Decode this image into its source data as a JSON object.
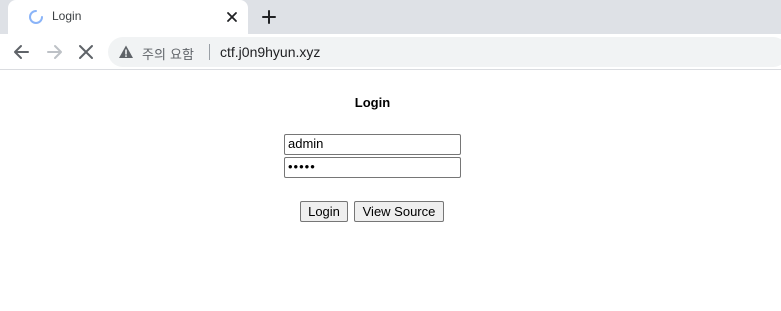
{
  "browser": {
    "tab": {
      "title": "Login"
    },
    "address_bar": {
      "security_label": "주의 요함",
      "url": "ctf.j0n9hyun.xyz"
    }
  },
  "page": {
    "heading": "Login",
    "username_value": "admin",
    "password_value": "•••••",
    "login_button": "Login",
    "view_source_button": "View Source"
  },
  "icons": {
    "tab_loading": "loading-spinner-icon",
    "tab_close": "close-icon",
    "new_tab": "plus-icon",
    "back": "arrow-left-icon",
    "forward": "arrow-right-icon",
    "stop": "stop-x-icon",
    "security": "warning-triangle-icon"
  },
  "colors": {
    "tabstrip": "#dee1e6",
    "omnibox": "#f1f3f4",
    "spinner": "#1a73e8"
  }
}
